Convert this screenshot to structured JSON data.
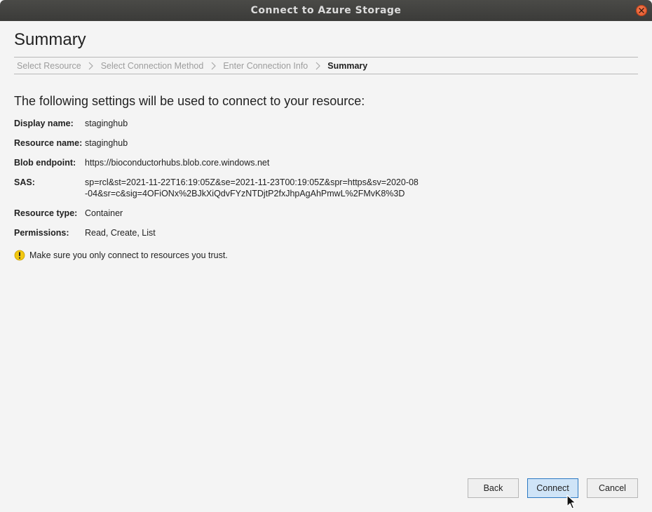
{
  "window": {
    "title": "Connect to Azure Storage"
  },
  "page": {
    "heading": "Summary"
  },
  "wizard": {
    "steps": [
      {
        "label": "Select Resource",
        "state": "inactive"
      },
      {
        "label": "Select Connection Method",
        "state": "inactive"
      },
      {
        "label": "Enter Connection Info",
        "state": "inactive"
      },
      {
        "label": "Summary",
        "state": "active"
      }
    ]
  },
  "summary": {
    "intro": "The following settings will be used to connect to your resource:",
    "fields": [
      {
        "label": "Display name:",
        "value": "staginghub"
      },
      {
        "label": "Resource name:",
        "value": "staginghub"
      },
      {
        "label": "Blob endpoint:",
        "value": "https://bioconductorhubs.blob.core.windows.net"
      },
      {
        "label": "SAS:",
        "value": "sp=rcl&st=2021-11-22T16:19:05Z&se=2021-11-23T00:19:05Z&spr=https&sv=2020-08-04&sr=c&sig=4OFiONx%2BJkXiQdvFYzNTDjtP2fxJhpAgAhPmwL%2FMvK8%3D"
      },
      {
        "label": "Resource type:",
        "value": "Container"
      },
      {
        "label": "Permissions:",
        "value": "Read, Create, List"
      }
    ],
    "warning": "Make sure you only connect to resources you trust."
  },
  "buttons": {
    "back": "Back",
    "connect": "Connect",
    "cancel": "Cancel"
  },
  "icons": {
    "close": "close-icon",
    "step_separator": "chevron-right-icon",
    "warning": "warning-icon",
    "cursor": "mouse-pointer-icon"
  },
  "colors": {
    "titlebar": "#3f3f3d",
    "close_button": "#e95420",
    "primary_button_bg": "#cfe4f7",
    "primary_button_border": "#2d79c2",
    "warning_icon": "#f2c811"
  }
}
